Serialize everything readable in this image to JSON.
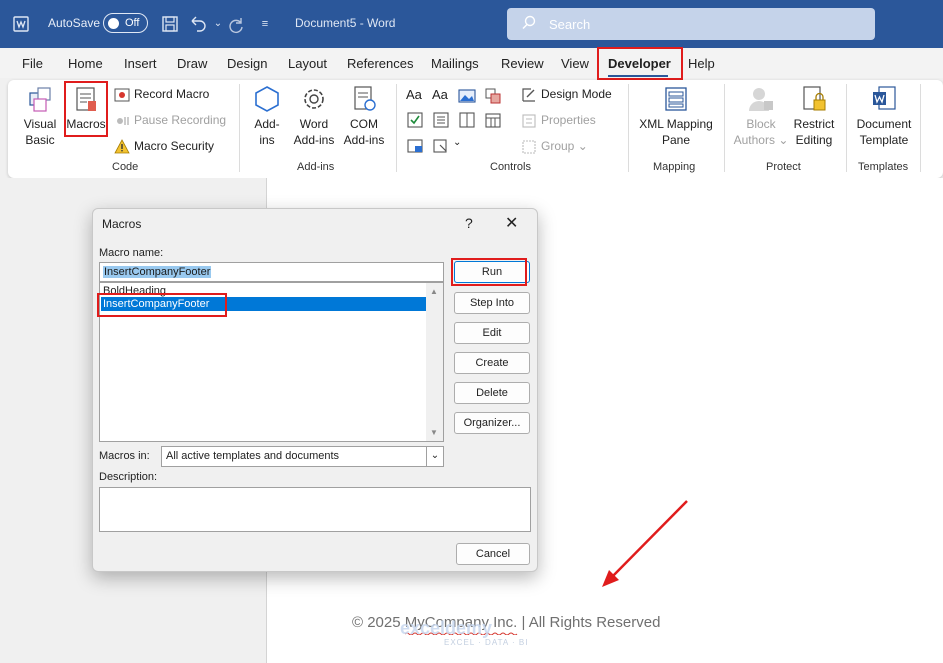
{
  "titlebar": {
    "autosave_label": "AutoSave",
    "autosave_state": "Off",
    "document_title": "Document5  -  Word",
    "search_placeholder": "Search"
  },
  "menu": {
    "items": [
      "File",
      "Home",
      "Insert",
      "Draw",
      "Design",
      "Layout",
      "References",
      "Mailings",
      "Review",
      "View",
      "Developer",
      "Help"
    ],
    "active": "Developer"
  },
  "ribbon": {
    "code": {
      "visual_basic": [
        "Visual",
        "Basic"
      ],
      "macros": "Macros",
      "record_macro": "Record Macro",
      "pause_recording": "Pause Recording",
      "macro_security": "Macro Security",
      "label": "Code"
    },
    "addins": {
      "addins": [
        "Add-",
        "ins"
      ],
      "word_addins": [
        "Word",
        "Add-ins"
      ],
      "com_addins": [
        "COM",
        "Add-ins"
      ],
      "label": "Add-ins"
    },
    "controls": {
      "design_mode": "Design Mode",
      "properties": "Properties",
      "group": "Group",
      "label": "Controls"
    },
    "mapping": {
      "xml_mapping": [
        "XML Mapping",
        "Pane"
      ],
      "label": "Mapping"
    },
    "protect": {
      "block_authors": [
        "Block",
        "Authors"
      ],
      "restrict_editing": [
        "Restrict",
        "Editing"
      ],
      "label": "Protect"
    },
    "templates": {
      "document_template": [
        "Document",
        "Template"
      ],
      "label": "Templates"
    }
  },
  "dialog": {
    "title": "Macros",
    "help": "?",
    "close": "✕",
    "macro_name_label": "Macro name:",
    "macro_name_value": "InsertCompanyFooter",
    "macros": [
      "BoldHeading",
      "InsertCompanyFooter"
    ],
    "selected_macro": "InsertCompanyFooter",
    "buttons": {
      "run": "Run",
      "step_into": "Step Into",
      "edit": "Edit",
      "create": "Create",
      "delete": "Delete",
      "organizer": "Organizer..."
    },
    "macros_in_label": "Macros in:",
    "macros_in_value": "All active templates and documents",
    "description_label": "Description:",
    "cancel": "Cancel"
  },
  "document": {
    "footer": "© 2025 MyCompany Inc. | All Rights Reserved",
    "watermark": "exceldemy",
    "watermark_sub": "EXCEL · DATA · BI"
  },
  "colors": {
    "word_blue": "#2b579a",
    "highlight_red": "#e01c1c",
    "selection_blue": "#0078d7"
  }
}
